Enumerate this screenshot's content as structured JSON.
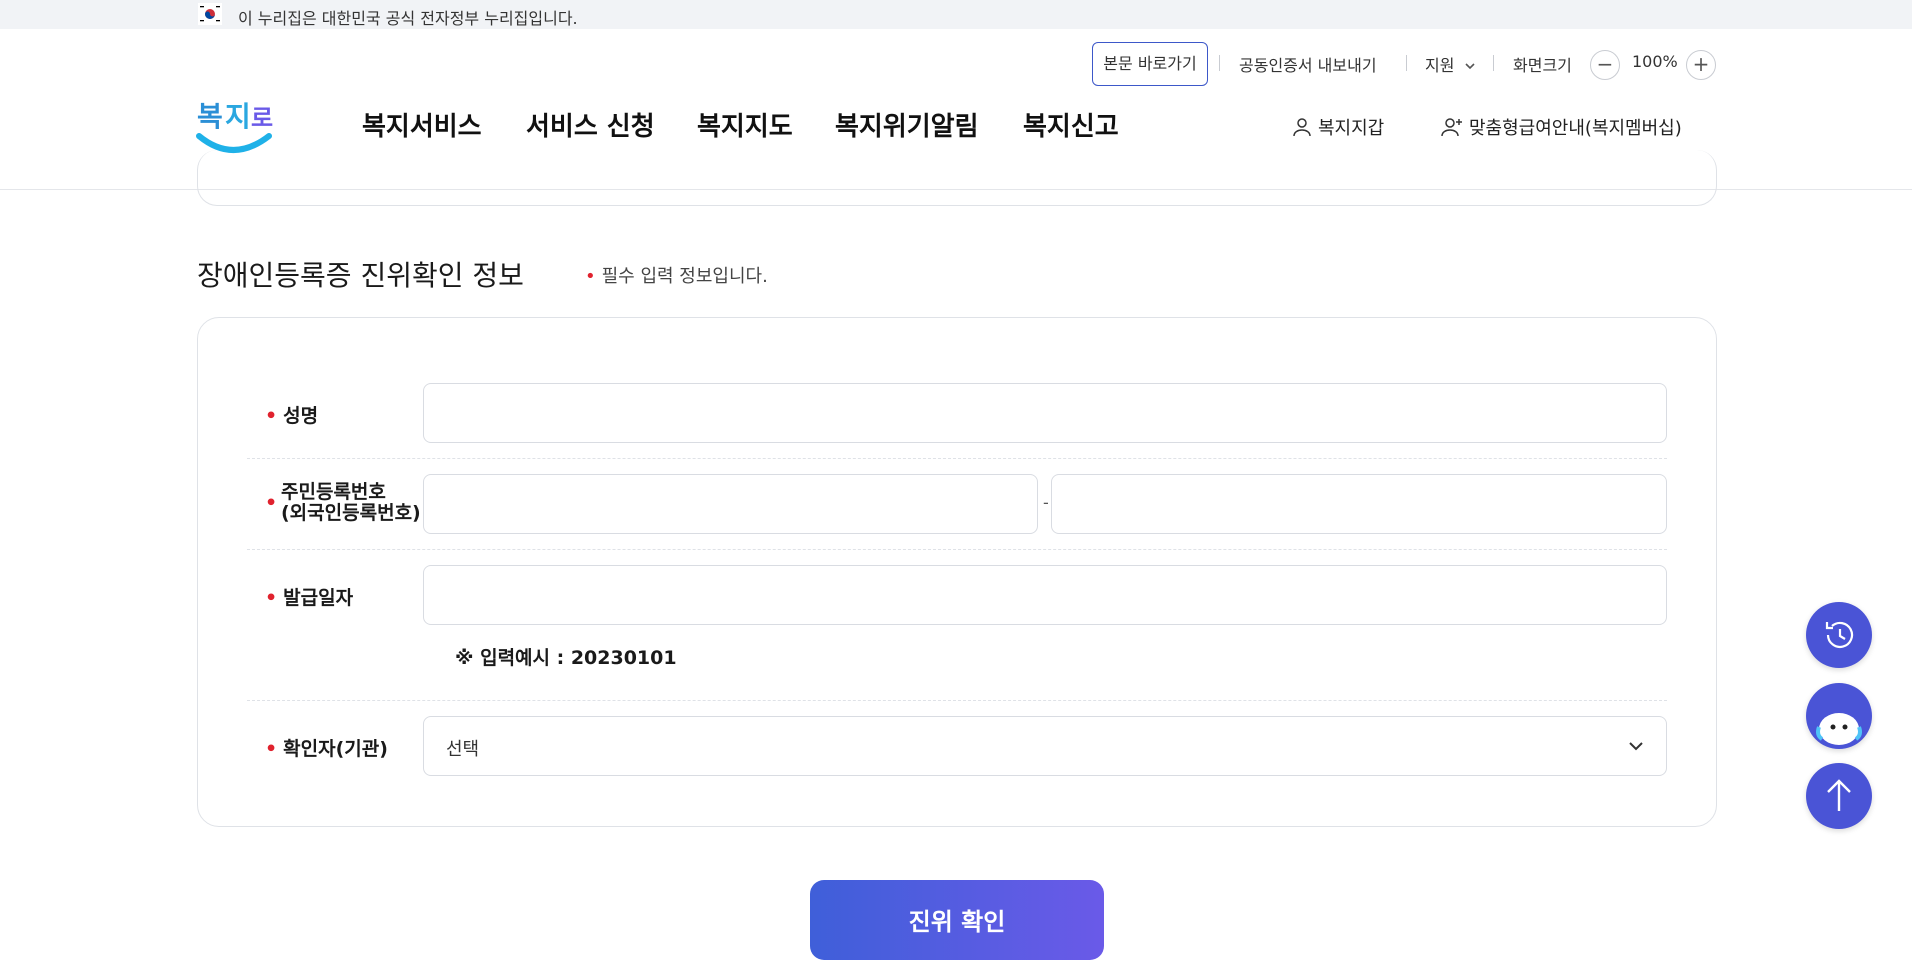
{
  "gov_banner": {
    "text": "이 누리집은 대한민국 공식 전자정부 누리집입니다."
  },
  "utility": {
    "skip_label": "본문 바로가기",
    "cert_export": "공동인증서 내보내기",
    "support": "지원",
    "screen_size": "화면크기",
    "zoom_level": "100%"
  },
  "logo": {
    "text": "복지로"
  },
  "gnb": [
    "복지서비스",
    "서비스 신청",
    "복지지도",
    "복지위기알림",
    "복지신고"
  ],
  "header_links": {
    "wallet": "복지지갑",
    "membership": "맞춤형급여안내(복지멤버십)"
  },
  "section": {
    "title": "장애인등록증 진위확인 정보",
    "required_note": "필수 입력 정보입니다."
  },
  "form": {
    "name_label": "성명",
    "rrn_label_1": "주민등록번호",
    "rrn_label_2": "(외국인등록번호)",
    "rrn_dash": "-",
    "issue_date_label": "발급일자",
    "issue_date_hint": "※ 입력예시 : 20230101",
    "verifier_label": "확인자(기관)",
    "verifier_selected": "선택"
  },
  "verify_button": "진위 확인",
  "colors": {
    "brand": "#3f5fd9",
    "required_dot": "#e0222e",
    "float_button": "#4a54d6"
  }
}
